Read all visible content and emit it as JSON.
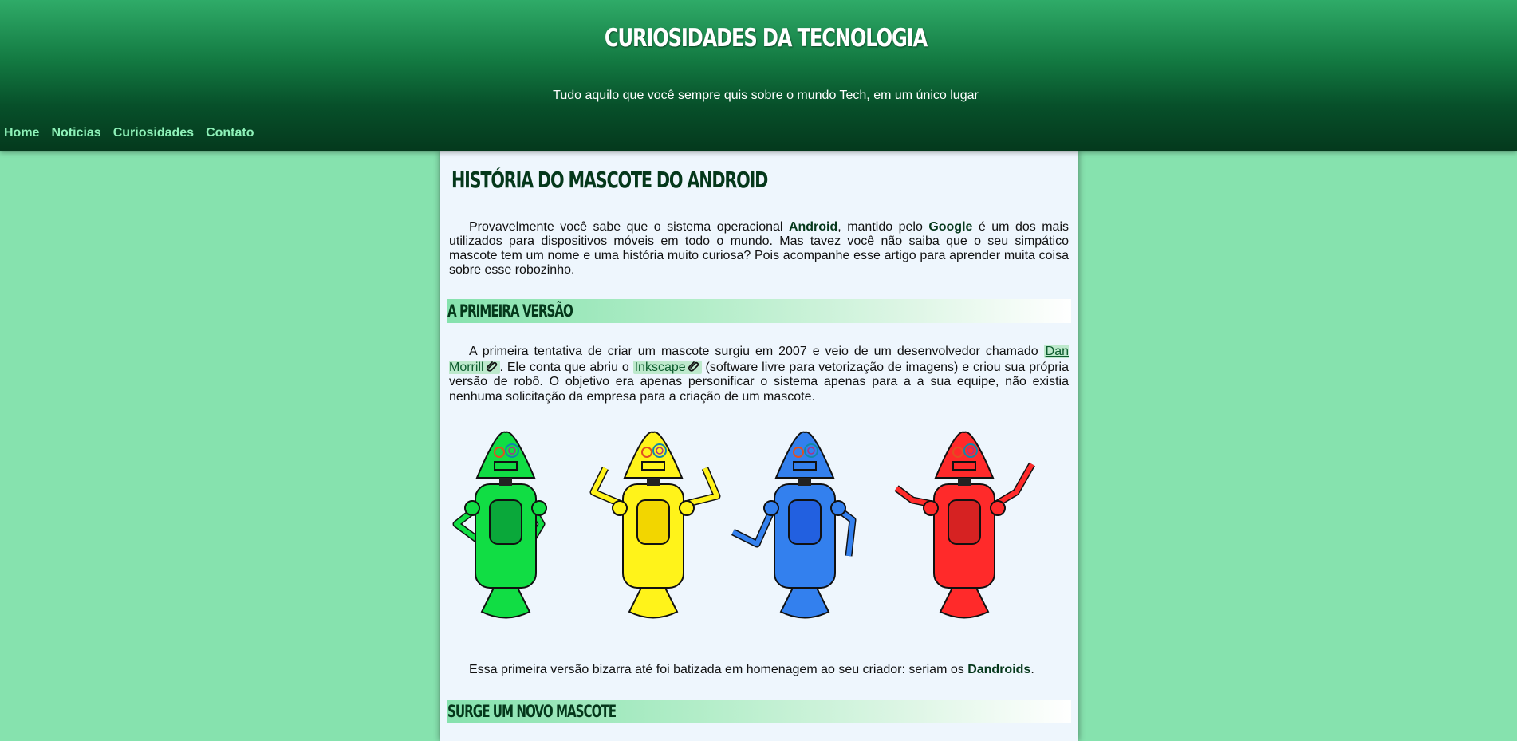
{
  "header": {
    "title": "CURIOSIDADES DA TECNOLOGIA",
    "subtitle": "Tudo aquilo que você sempre quis sobre o mundo Tech, em um único lugar"
  },
  "nav": {
    "items": [
      {
        "label": "Home"
      },
      {
        "label": "Noticias"
      },
      {
        "label": "Curiosidades"
      },
      {
        "label": "Contato"
      }
    ]
  },
  "article": {
    "title": "HISTÓRIA DO MASCOTE DO ANDROID",
    "intro": {
      "t1": "Provavelmente você sabe que o sistema operacional ",
      "b1": "Android",
      "t2": ", mantido pelo ",
      "b2": "Google",
      "t3": " é um dos mais utilizados para dispositivos móveis em todo o mundo. Mas tavez você não saiba que o seu simpático mascote tem um nome e uma história muito curiosa? Pois acompanhe esse artigo para aprender muita coisa sobre esse robozinho."
    },
    "section1": {
      "heading": "A PRIMEIRA VERSÃO",
      "p1": {
        "t1": "A primeira tentativa de criar um mascote surgiu em 2007 e veio de um desenvolvedor chamado ",
        "link1": "Dan Morrill",
        "t2": ". Ele conta que abriu o ",
        "link2": "Inkscape",
        "t3": " (software livre para vetorização de imagens) e criou sua própria versão de robô. O objetivo era apenas personificar o sistema apenas para a a sua equipe, não existia nenhuma solicitação da empresa para a criação de um mascote."
      },
      "robots": [
        {
          "color": "#11dd44",
          "dark": "#0aa83a"
        },
        {
          "color": "#fff31a",
          "dark": "#f2d600"
        },
        {
          "color": "#3380ee",
          "dark": "#2260e0"
        },
        {
          "color": "#ff2a2a",
          "dark": "#d62222"
        }
      ],
      "p2": {
        "t1": "Essa primeira versão bizarra até foi batizada em homenagem ao seu criador: seriam os ",
        "b1": "Dandroids",
        "t2": "."
      }
    },
    "section2": {
      "heading": "SURGE UM NOVO MASCOTE"
    }
  },
  "colors": {
    "background": "#86e2ae",
    "header_dark": "#04391d",
    "nav_link": "#8ef1b8",
    "content_bg": "#eef6fd",
    "heading": "#05381b"
  }
}
